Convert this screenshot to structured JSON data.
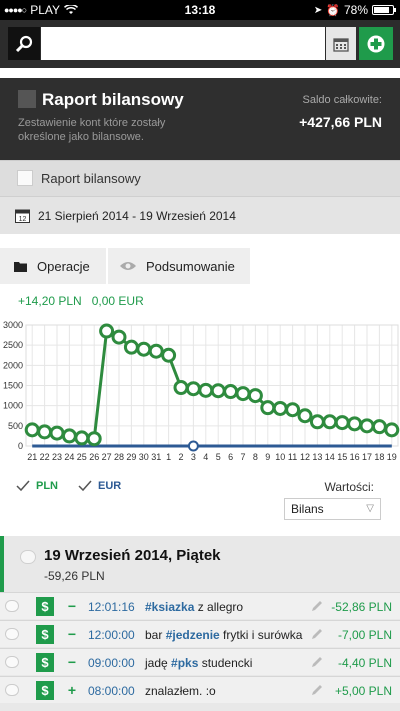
{
  "status": {
    "carrier": "PLAY",
    "time": "13:18",
    "battery": "78%"
  },
  "search": {
    "placeholder": ""
  },
  "header": {
    "title": "Raport bilansowy",
    "description": "Zestawienie kont które zostały określone jako bilansowe.",
    "saldo_label": "Saldo całkowite:",
    "saldo_value": "+427,66 PLN"
  },
  "filter": {
    "label": "Raport bilansowy"
  },
  "date_range": "21 Sierpień 2014 - 19 Wrzesień 2014",
  "tabs": {
    "operations": "Operacje",
    "summary": "Podsumowanie"
  },
  "totals": {
    "pln": "+14,20 PLN",
    "eur": "0,00 EUR"
  },
  "chart_data": {
    "type": "line",
    "x": [
      "21",
      "22",
      "23",
      "24",
      "25",
      "26",
      "27",
      "28",
      "29",
      "30",
      "31",
      "1",
      "2",
      "3",
      "4",
      "5",
      "6",
      "7",
      "8",
      "9",
      "10",
      "11",
      "12",
      "13",
      "14",
      "15",
      "16",
      "17",
      "18",
      "19"
    ],
    "series": [
      {
        "name": "PLN",
        "values": [
          400,
          350,
          320,
          250,
          200,
          180,
          2850,
          2700,
          2450,
          2400,
          2350,
          2250,
          1450,
          1420,
          1380,
          1370,
          1350,
          1300,
          1250,
          950,
          930,
          900,
          750,
          600,
          600,
          580,
          550,
          500,
          480,
          400
        ],
        "color": "#2e8b3e"
      },
      {
        "name": "EUR",
        "values": [
          0,
          0,
          0,
          0,
          0,
          0,
          0,
          0,
          0,
          0,
          0,
          0,
          0,
          0,
          0,
          0,
          0,
          0,
          0,
          0,
          0,
          0,
          0,
          0,
          0,
          0,
          0,
          0,
          0,
          0
        ],
        "color": "#2d5a94"
      }
    ],
    "y_ticks": [
      "0",
      "500",
      "1000",
      "1500",
      "2000",
      "2500",
      "3000"
    ],
    "ylim": [
      0,
      3000
    ],
    "grid": true
  },
  "legend": {
    "pln": "PLN",
    "eur": "EUR"
  },
  "values_control": {
    "label": "Wartości:",
    "selected": "Bilans"
  },
  "day": {
    "title": "19 Wrzesień 2014, Piątek",
    "total": "-59,26 PLN"
  },
  "transactions": [
    {
      "sign": "−",
      "time": "12:01:16",
      "pre": "",
      "tag": "#ksiazka",
      "post": " z allegro",
      "amount": "-52,86 PLN"
    },
    {
      "sign": "−",
      "time": "12:00:00",
      "pre": "bar ",
      "tag": "#jedzenie",
      "post": " frytki i surówka",
      "amount": "-7,00 PLN"
    },
    {
      "sign": "−",
      "time": "09:00:00",
      "pre": "jadę ",
      "tag": "#pks",
      "post": " studencki",
      "amount": "-4,40 PLN"
    },
    {
      "sign": "+",
      "time": "08:00:00",
      "pre": "znalazłem. :o",
      "tag": "",
      "post": "",
      "amount": "+5,00 PLN"
    }
  ]
}
